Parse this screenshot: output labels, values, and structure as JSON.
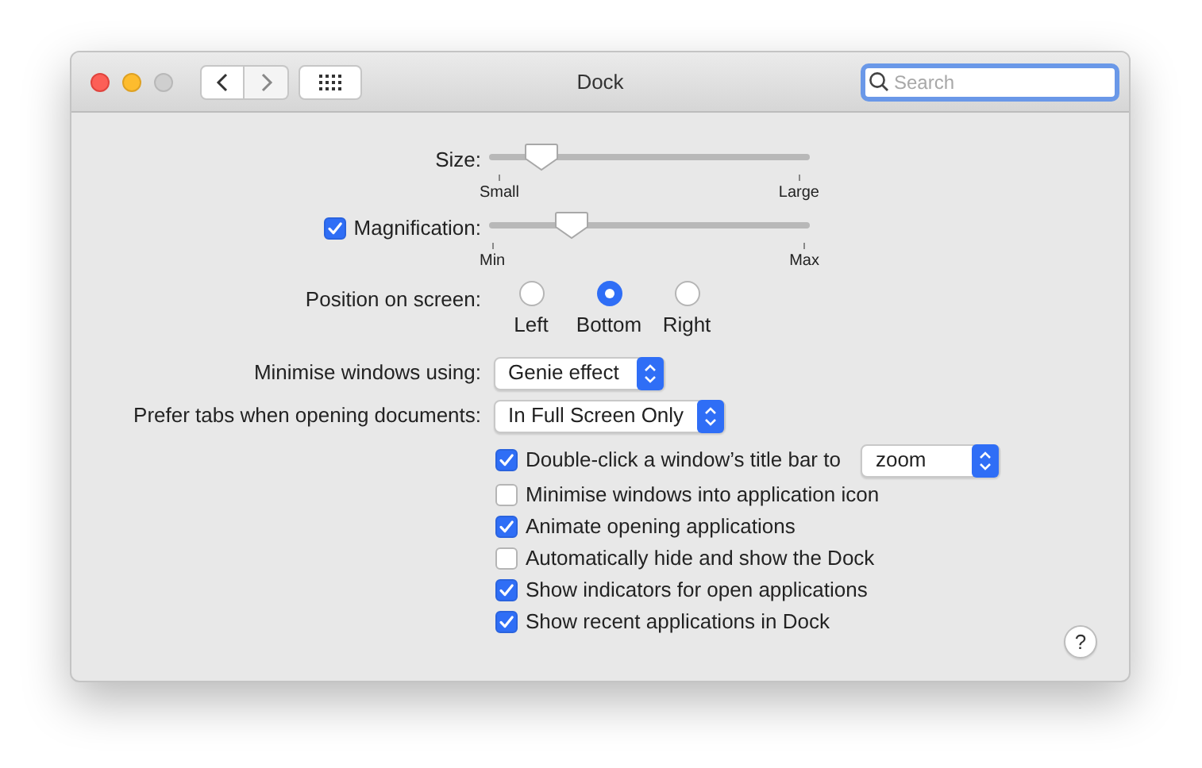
{
  "window": {
    "title": "Dock"
  },
  "search": {
    "placeholder": "Search"
  },
  "size": {
    "label": "Size:",
    "level": 0.12,
    "min_label": "Small",
    "max_label": "Large"
  },
  "magnification": {
    "label": "Magnification:",
    "checked": true,
    "level": 0.23,
    "min_label": "Min",
    "max_label": "Max"
  },
  "position": {
    "label": "Position on screen:",
    "options": [
      {
        "label": "Left",
        "selected": false
      },
      {
        "label": "Bottom",
        "selected": true
      },
      {
        "label": "Right",
        "selected": false
      }
    ]
  },
  "minimise_using": {
    "label": "Minimise windows using:",
    "value": "Genie effect"
  },
  "prefer_tabs": {
    "label": "Prefer tabs when opening documents:",
    "value": "In Full Screen Only"
  },
  "options": [
    {
      "label": "Double-click a window’s title bar to",
      "checked": true,
      "popup_value": "zoom"
    },
    {
      "label": "Minimise windows into application icon",
      "checked": false
    },
    {
      "label": "Animate opening applications",
      "checked": true
    },
    {
      "label": "Automatically hide and show the Dock",
      "checked": false
    },
    {
      "label": "Show indicators for open applications",
      "checked": true
    },
    {
      "label": "Show recent applications in Dock",
      "checked": true
    }
  ],
  "help": "?"
}
